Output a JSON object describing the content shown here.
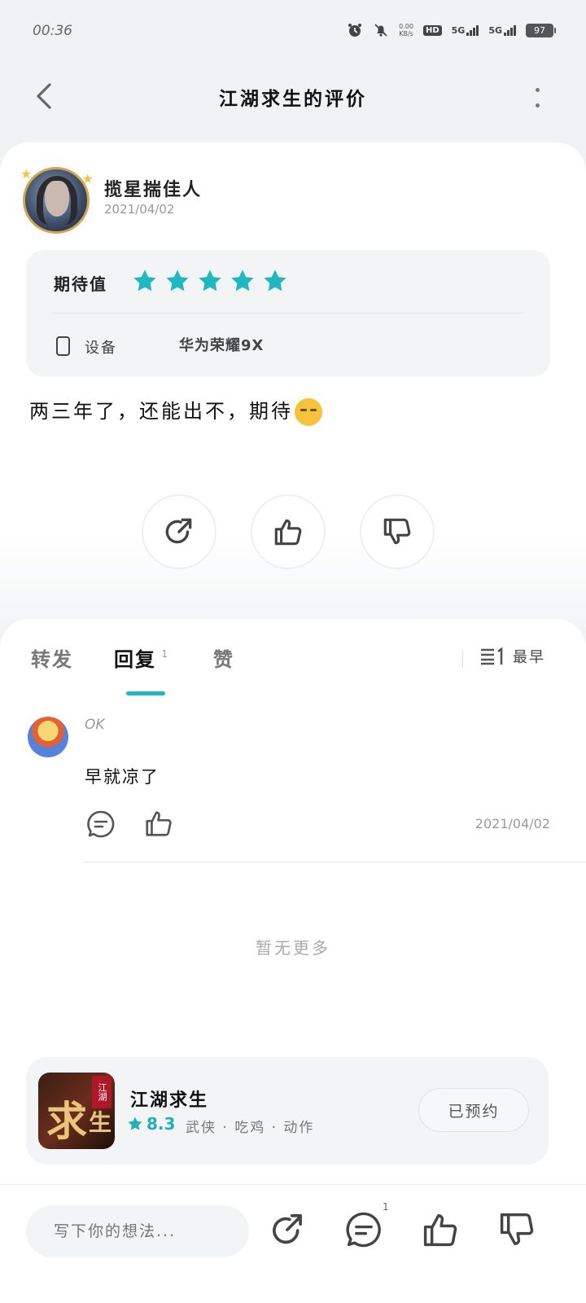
{
  "status_bar": {
    "time": "00:36",
    "net_speed_value": "0.00",
    "net_speed_unit": "KB/s",
    "hd_label": "HD",
    "signal1": "5G",
    "signal2": "5G",
    "battery": "97"
  },
  "header": {
    "title": "江湖求生的评价"
  },
  "review": {
    "user_name": "揽星揣佳人",
    "date": "2021/04/02",
    "expect_label": "期待值",
    "stars": 5,
    "device_label": "设备",
    "device_value": "华为荣耀9X",
    "text": "两三年了，还能出不，期待"
  },
  "tabs": {
    "forward": "转发",
    "reply": "回复",
    "reply_count": "1",
    "like": "赞",
    "sort_label": "最早"
  },
  "reply_item": {
    "name": "OK",
    "text": "早就凉了",
    "date": "2021/04/02"
  },
  "list_end": "暂无更多",
  "game": {
    "name": "江湖求生",
    "icon_big": "求",
    "icon_small": "生",
    "icon_ribbon": "江湖",
    "rating": "8.3",
    "tags": "武侠 · 吃鸡 · 动作",
    "reserve_label": "已预约"
  },
  "bottom_bar": {
    "input_placeholder": "写下你的想法...",
    "comment_count": "1"
  },
  "colors": {
    "accent": "#1fb8c1",
    "star": "#1fb8c1"
  }
}
